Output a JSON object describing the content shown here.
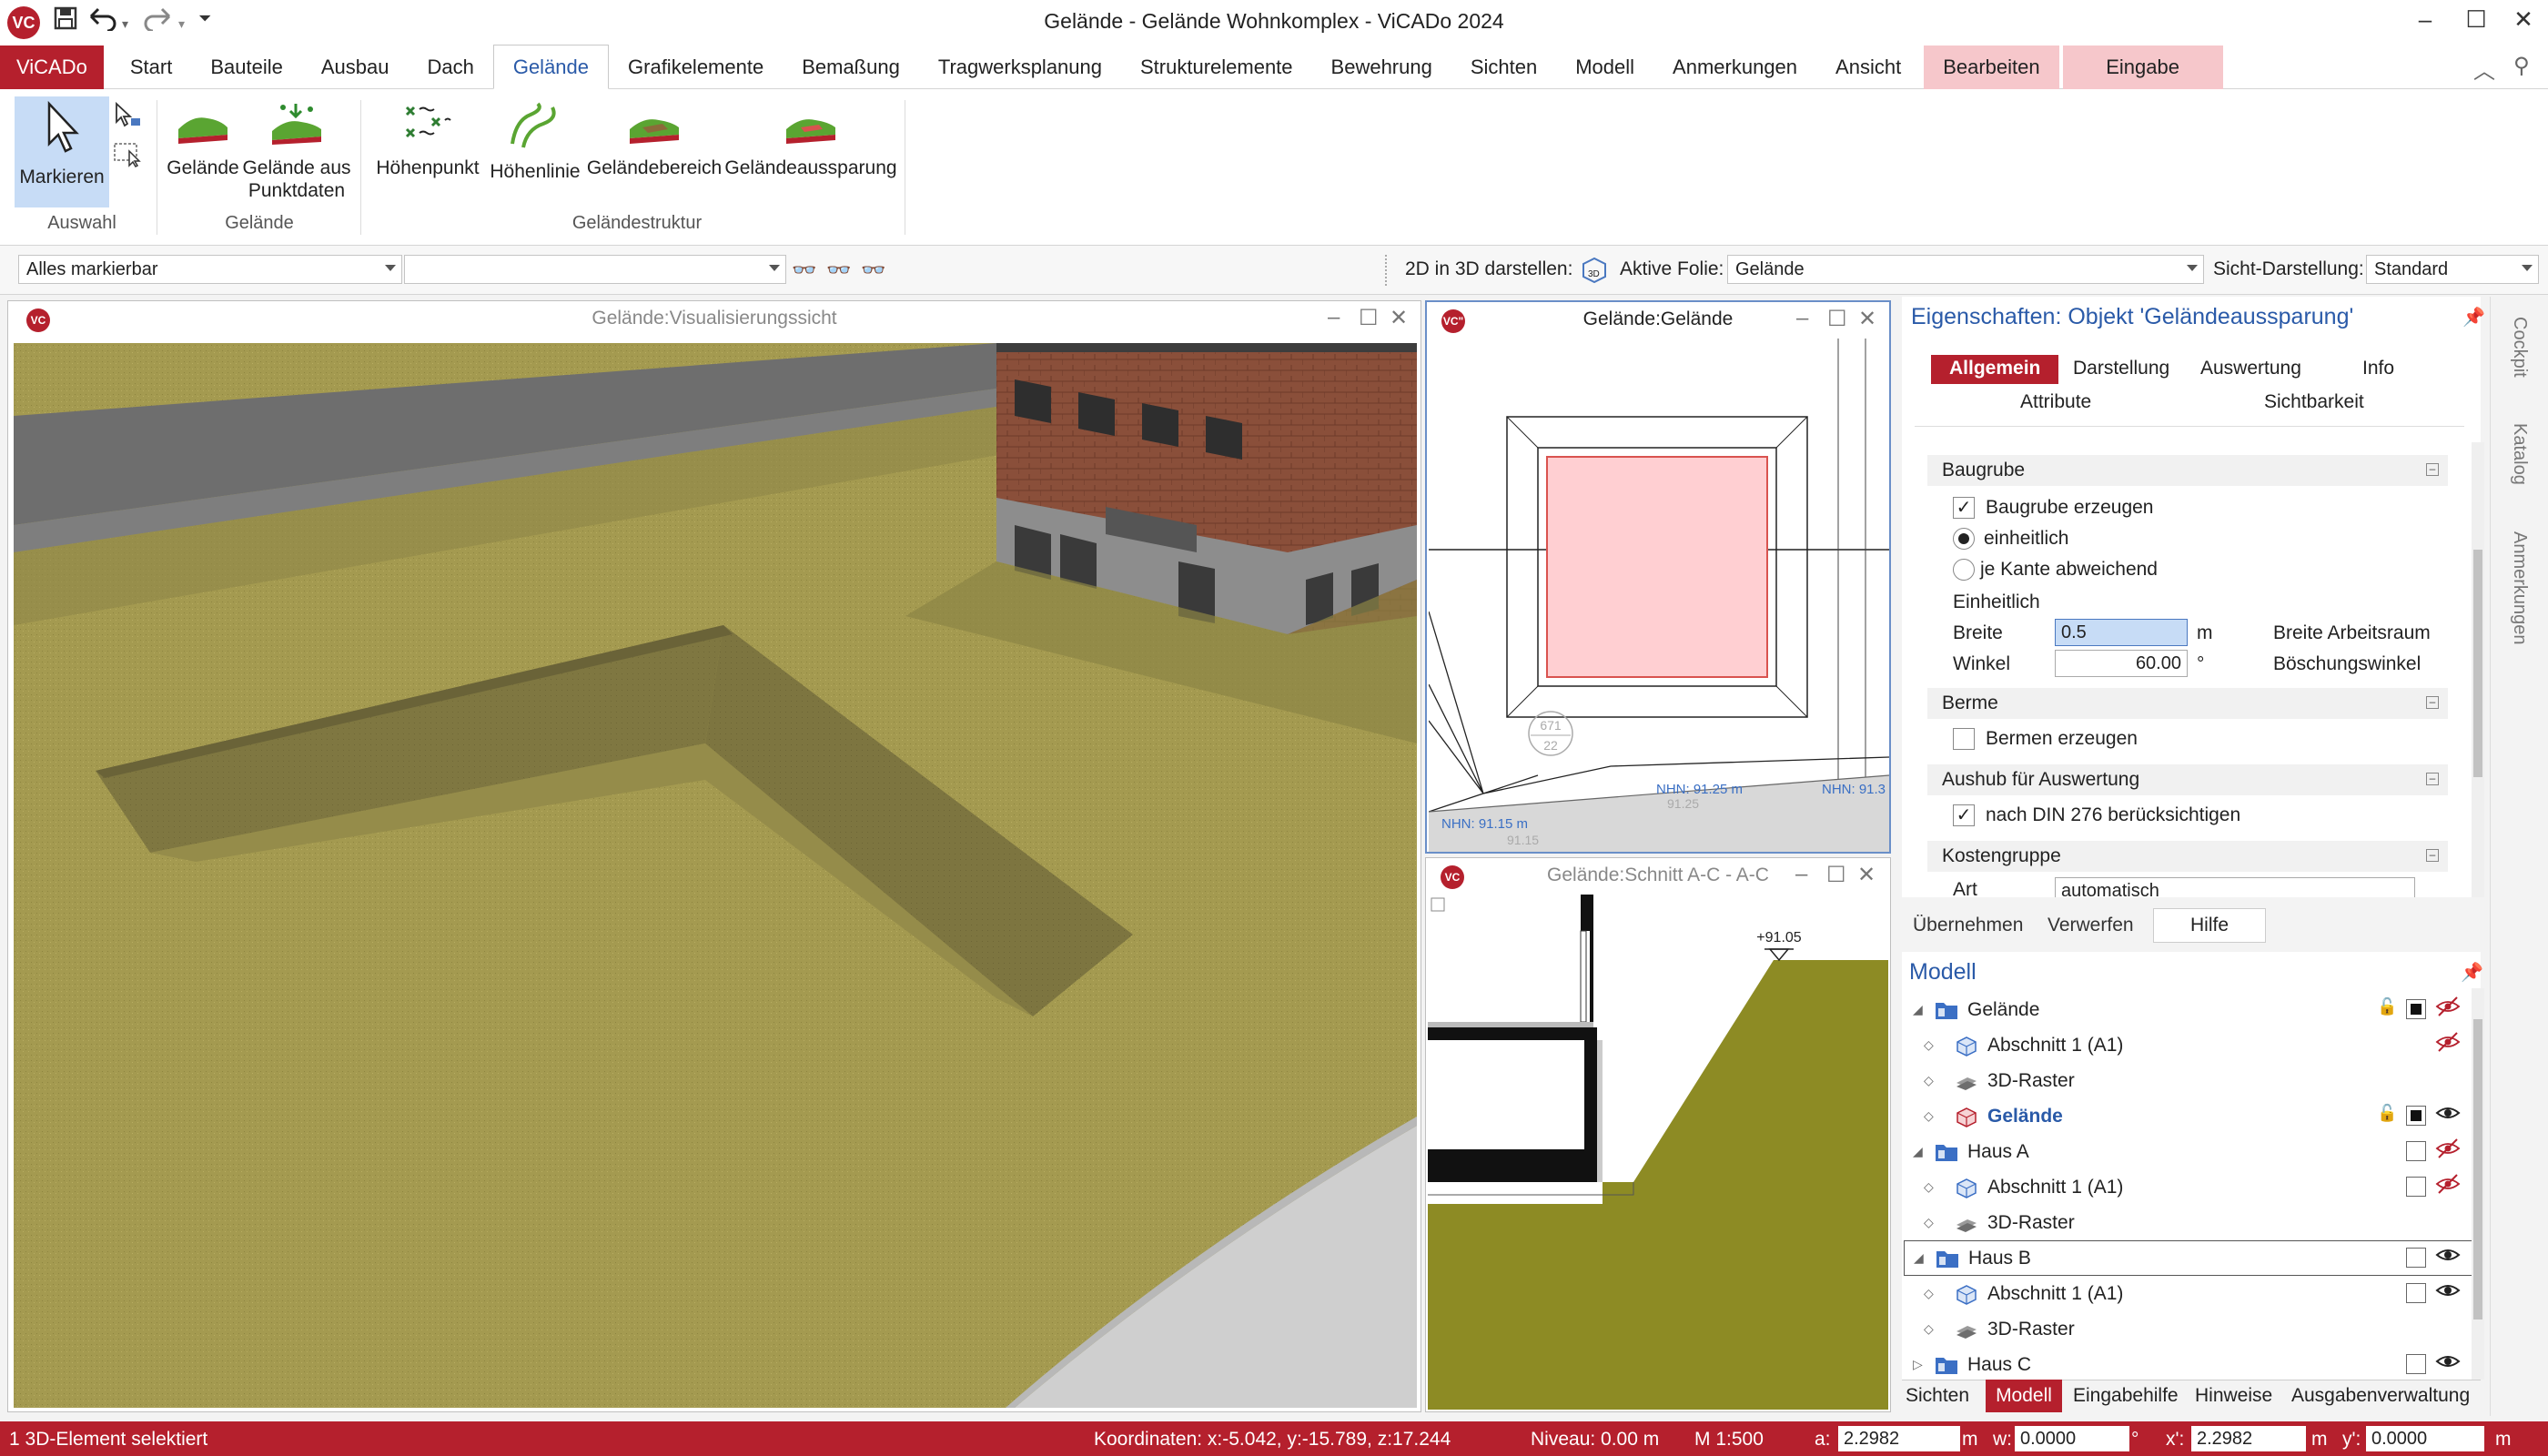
{
  "window": {
    "title": "Gelände - Gelände Wohnkomplex - ViCADo 2024",
    "app_icon": "VC"
  },
  "tabs": [
    {
      "label": "ViCADo",
      "style": "app"
    },
    {
      "label": "Start"
    },
    {
      "label": "Bauteile"
    },
    {
      "label": "Ausbau"
    },
    {
      "label": "Dach"
    },
    {
      "label": "Gelände",
      "style": "active"
    },
    {
      "label": "Grafikelemente"
    },
    {
      "label": "Bemaßung"
    },
    {
      "label": "Tragwerksplanung"
    },
    {
      "label": "Strukturelemente"
    },
    {
      "label": "Bewehrung"
    },
    {
      "label": "Sichten"
    },
    {
      "label": "Modell"
    },
    {
      "label": "Anmerkungen"
    },
    {
      "label": "Ansicht"
    },
    {
      "label": "Bearbeiten",
      "style": "pink"
    },
    {
      "label": "Eingabe",
      "style": "pink-wide"
    }
  ],
  "ribbon": {
    "markieren": "Markieren",
    "gelaende": "Gelände",
    "gelaende_punktdaten_1": "Gelände aus",
    "gelaende_punktdaten_2": "Punktdaten",
    "hoehenpunkt": "Höhenpunkt",
    "hoehenlinie": "Höhenlinie",
    "gelaendebereich": "Geländebereich",
    "gelaendeaussparung": "Geländeaussparung",
    "group_auswahl": "Auswahl",
    "group_gelaende": "Gelände",
    "group_struktur": "Geländestruktur"
  },
  "toolbar": {
    "select_filter": "Alles markierbar",
    "second_combo": "",
    "label_2d3d": "2D in 3D darstellen:",
    "label_folie": "Aktive Folie:",
    "folie_value": "Gelände",
    "label_sicht": "Sicht-Darstellung:",
    "sicht_value": "Standard"
  },
  "views": {
    "visualisierung": "Gelände:Visualisierungssicht",
    "gelaende": "Gelände:Gelände",
    "schnitt": "Gelände:Schnitt A-C - A-C",
    "plan_label_1": "NHN: 91.25 m",
    "plan_label_1b": "91.25",
    "plan_label_2": "NHN: 91.15 m",
    "plan_label_2b": "91.15",
    "plan_label_3": "NHN: 91.3",
    "plan_circle": "671\n22",
    "section_level": "+91.05"
  },
  "properties": {
    "title": "Eigenschaften: Objekt 'Geländeaussparung'",
    "tabs": [
      "Allgemein",
      "Darstellung",
      "Auswertung",
      "Info",
      "Attribute",
      "Sichtbarkeit"
    ],
    "baugrube": "Baugrube",
    "baugrube_erzeugen": "Baugrube erzeugen",
    "einheitlich_radio": "einheitlich",
    "je_kante": "je Kante abweichend",
    "einheitlich_label": "Einheitlich",
    "breite": "Breite",
    "breite_value": "0.5",
    "breite_unit": "m",
    "breite_desc": "Breite Arbeitsraum",
    "winkel": "Winkel",
    "winkel_value": "60.00",
    "winkel_unit": "°",
    "winkel_desc": "Böschungswinkel",
    "berme": "Berme",
    "bermen_erzeugen": "Bermen erzeugen",
    "aushub": "Aushub für Auswertung",
    "din": "nach DIN 276 berücksichtigen",
    "kostengruppe": "Kostengruppe",
    "art": "Art",
    "art_value": "automatisch",
    "uebernehmen": "Übernehmen",
    "verwerfen": "Verwerfen",
    "hilfe": "Hilfe"
  },
  "model": {
    "title": "Modell",
    "rows": [
      {
        "label": "Gelände",
        "level": 0,
        "icon": "folder"
      },
      {
        "label": "Abschnitt 1 (A1)",
        "level": 1,
        "icon": "section"
      },
      {
        "label": "3D-Raster",
        "level": 1,
        "icon": "grid"
      },
      {
        "label": "Gelände",
        "level": 1,
        "icon": "terrain",
        "bold": true
      },
      {
        "label": "Haus A",
        "level": 0,
        "icon": "folder"
      },
      {
        "label": "Abschnitt 1 (A1)",
        "level": 1,
        "icon": "section"
      },
      {
        "label": "3D-Raster",
        "level": 1,
        "icon": "grid"
      },
      {
        "label": "Haus B",
        "level": 0,
        "icon": "folder"
      },
      {
        "label": "Abschnitt 1 (A1)",
        "level": 1,
        "icon": "section"
      },
      {
        "label": "3D-Raster",
        "level": 1,
        "icon": "grid"
      },
      {
        "label": "Haus C",
        "level": 0,
        "icon": "folder"
      }
    ],
    "bottom_tabs": [
      "Sichten",
      "Modell",
      "Eingabehilfe",
      "Hinweise",
      "Ausgabenverwaltung"
    ]
  },
  "side_tabs": [
    "Cockpit",
    "Katalog",
    "Anmerkungen"
  ],
  "status": {
    "left": "1 3D-Element selektiert",
    "koordinaten": "Koordinaten: x:-5.042, y:-15.789, z:17.244",
    "niveau": "Niveau: 0.00 m",
    "massstab": "M 1:500",
    "a_label": "a:",
    "a_value": "2.2982",
    "a_unit": "m",
    "w_label": "w:",
    "w_value": "0.0000",
    "w_unit": "°",
    "x_label": "x':",
    "x_value": "2.2982",
    "x_unit": "m",
    "y_label": "y':",
    "y_value": "0.0000",
    "y_unit": "m"
  }
}
